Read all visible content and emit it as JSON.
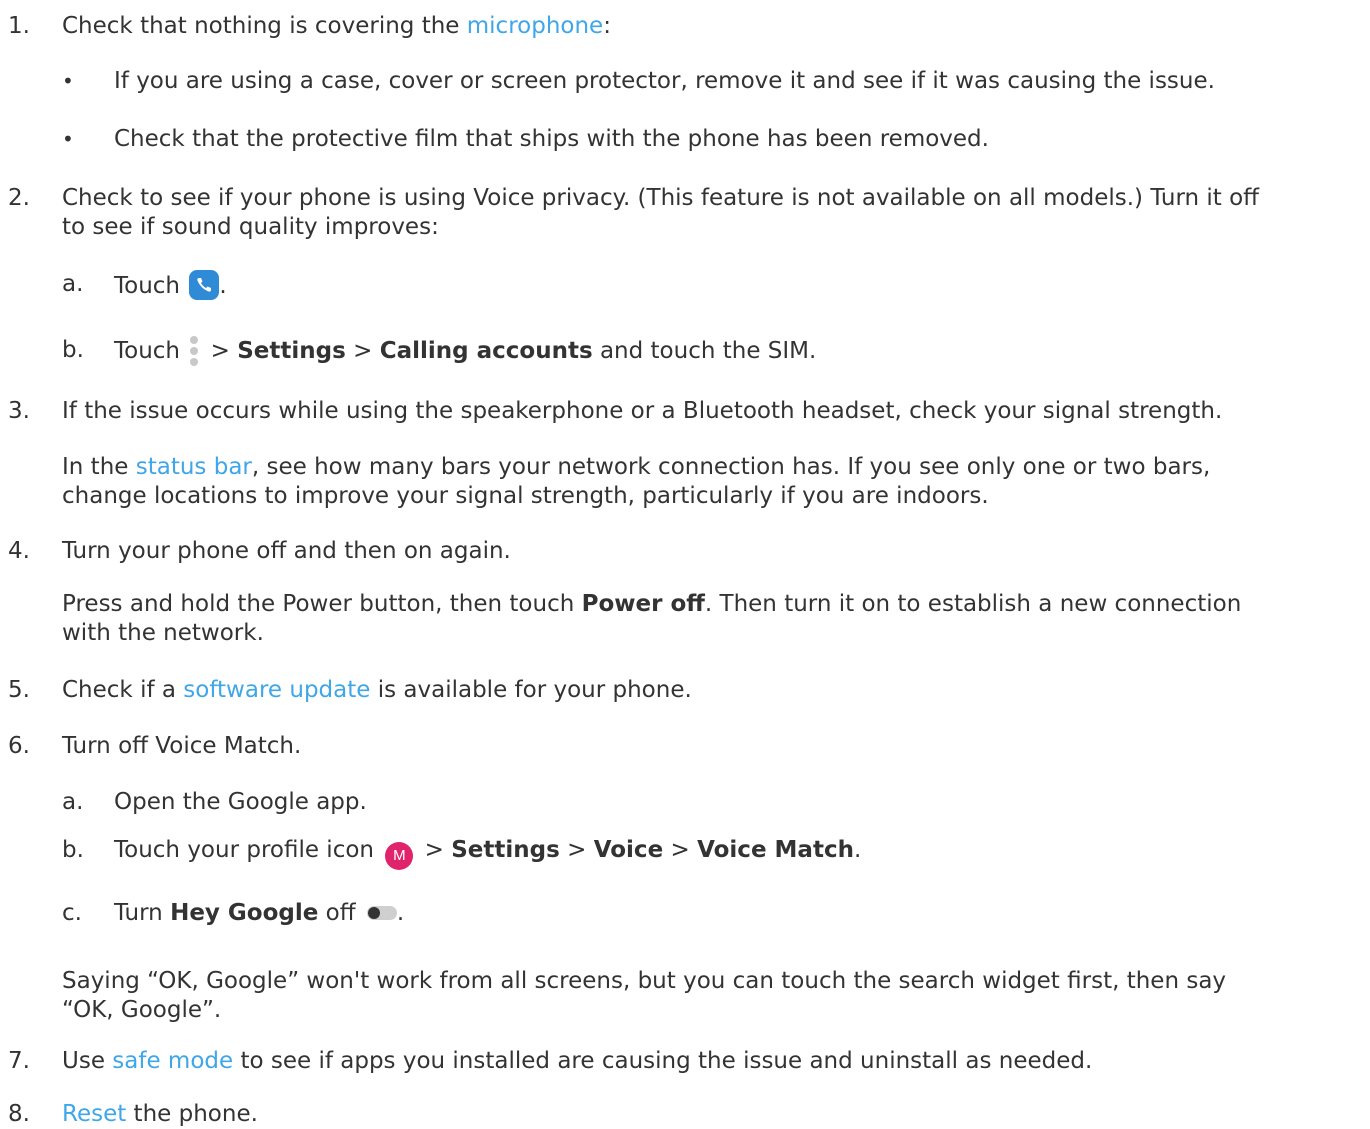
{
  "steps": {
    "s1": {
      "number": "1.",
      "pre": "Check that nothing is covering the ",
      "link": "microphone",
      "post": ":",
      "bullets": [
        "If you are using a case, cover or screen protector, remove it and see if it was causing the issue.",
        "Check that the protective film that ships with the phone has been removed."
      ]
    },
    "s2": {
      "number": "2.",
      "line1": "Check to see if your phone is using Voice privacy. (This feature is not available on all models.) Turn it off",
      "line2": "to see if sound quality improves:",
      "a": {
        "letter": "a.",
        "pre": "Touch ",
        "post": ".",
        "icon": "phone-app-icon"
      },
      "b": {
        "letter": "b.",
        "pre": "Touch ",
        "sep1": " > ",
        "bold1": "Settings",
        "sep2": " > ",
        "bold2": "Calling accounts",
        "post": " and touch the SIM.",
        "icon": "more-options-icon"
      }
    },
    "s3": {
      "number": "3.",
      "line1": "If the issue occurs while using the speakerphone or a Bluetooth headset, check your signal strength.",
      "para_pre": "In the ",
      "para_link": "status bar",
      "para_post": ", see how many bars your network connection has. If you see only one or two bars,",
      "para_line2": "change locations to improve your signal strength, particularly if you are indoors."
    },
    "s4": {
      "number": "4.",
      "line1": "Turn your phone off and then on again.",
      "para_pre": "Press and hold the Power button, then touch ",
      "para_bold": "Power off",
      "para_post": ". Then turn it on to establish a new connection",
      "para_line2": "with the network."
    },
    "s5": {
      "number": "5.",
      "pre": "Check if a ",
      "link": "software update",
      "post": " is available for your phone."
    },
    "s6": {
      "number": "6.",
      "line1": "Turn off Voice Match.",
      "a": {
        "letter": "a.",
        "text": "Open the Google app."
      },
      "b": {
        "letter": "b.",
        "pre": "Touch your profile icon ",
        "avatar_letter": "M",
        "sep1": " > ",
        "bold1": "Settings",
        "sep2": " > ",
        "bold2": "Voice",
        "sep3": " > ",
        "bold3": "Voice Match",
        "post": "."
      },
      "c": {
        "letter": "c.",
        "pre": "Turn ",
        "bold": "Hey Google",
        "mid": " off ",
        "post": ".",
        "icon": "toggle-off-icon"
      },
      "para_line1": "Saying “OK, Google” won't work from all screens, but you can touch the search widget first, then say",
      "para_line2": "“OK, Google”."
    },
    "s7": {
      "number": "7.",
      "pre": "Use ",
      "link": "safe mode",
      "post": " to see if apps you installed are causing the issue and uninstall as needed."
    },
    "s8": {
      "number": "8.",
      "link": "Reset",
      "post": " the phone."
    }
  },
  "colors": {
    "link": "#3fa6e8",
    "text": "#333333",
    "phone_icon_bg": "#2f8bd6",
    "avatar_bg": "#e0246b"
  }
}
